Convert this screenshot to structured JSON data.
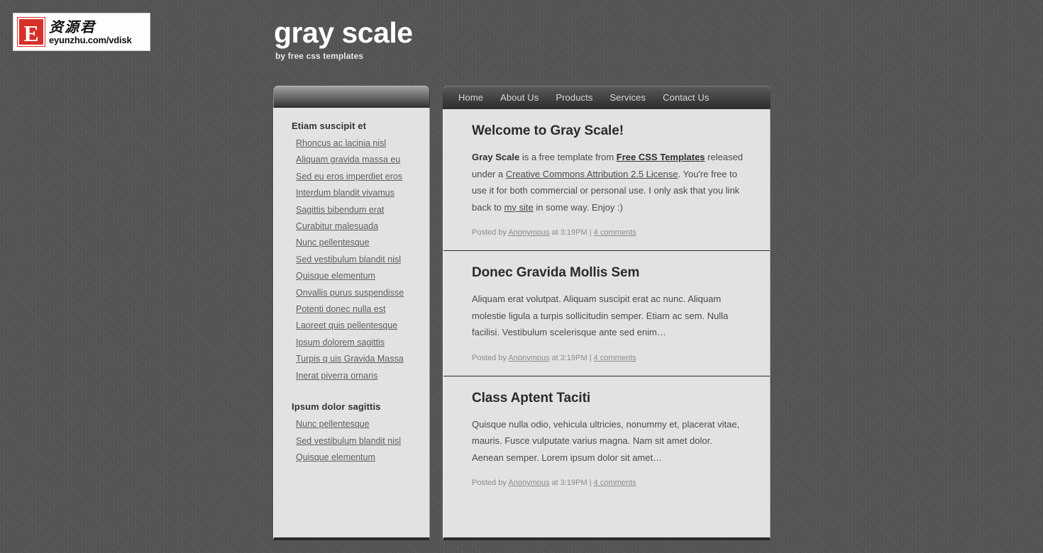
{
  "logo": {
    "mark_letter": "E",
    "chinese_text": "资源君",
    "url_text": "eyunzhu.com/vdisk"
  },
  "header": {
    "title": "gray scale",
    "tagline": "by free css templates"
  },
  "nav": {
    "items": [
      {
        "label": "Home"
      },
      {
        "label": "About Us"
      },
      {
        "label": "Products"
      },
      {
        "label": "Services"
      },
      {
        "label": "Contact Us"
      }
    ]
  },
  "sidebar": {
    "sections": [
      {
        "heading": "Etiam suscipit et",
        "links": [
          "Rhoncus ac lacinia nisl",
          "Aliquam gravida massa eu",
          "Sed eu eros imperdiet eros",
          "Interdum blandit vivamus",
          "Sagittis bibendum erat",
          "Curabitur malesuada",
          "Nunc pellentesque",
          "Sed vestibulum blandit nisl",
          "Quisque elementum",
          "Onvallis purus suspendisse",
          "Potenti donec nulla est",
          "Laoreet quis pellentesque",
          "Ipsum dolorem sagittis",
          "Turpis q uis Gravida Massa",
          "Inerat piverra ornaris"
        ]
      },
      {
        "heading": "Ipsum dolor sagittis",
        "links": [
          "Nunc pellentesque",
          "Sed vestibulum blandit nisl",
          "Quisque elementum"
        ]
      }
    ]
  },
  "posts": [
    {
      "title": "Welcome to Gray Scale!",
      "body_lead": "Gray Scale",
      "body_1": " is a free template from ",
      "link_1": "Free CSS Templates",
      "body_2": " released under a ",
      "link_2": "Creative Commons Attribution 2.5 License",
      "body_3": ". You're free to use it for both commercial or personal use. I only ask that you link back to ",
      "link_3": "my site",
      "body_4": " in some way. Enjoy :)",
      "meta_posted_by": "Posted by",
      "meta_author": "Anonymous",
      "meta_at": "at 3:19PM |",
      "meta_comments": "4 comments"
    },
    {
      "title": "Donec Gravida Mollis Sem",
      "body": "Aliquam erat volutpat. Aliquam suscipit erat ac nunc. Aliquam molestie ligula a turpis sollicitudin semper. Etiam ac sem. Nulla facilisi. Vestibulum scelerisque ante sed enim…",
      "meta_posted_by": "Posted by",
      "meta_author": "Anonymous",
      "meta_at": "at 3:19PM |",
      "meta_comments": "4 comments"
    },
    {
      "title": "Class Aptent Taciti",
      "body": "Quisque nulla odio, vehicula ultricies, nonummy et, placerat vitae, mauris. Fusce vulputate varius magna. Nam sit amet dolor. Aenean semper. Lorem ipsum dolor sit amet…",
      "meta_posted_by": "Posted by",
      "meta_author": "Anonymous",
      "meta_at": "at 3:19PM |",
      "meta_comments": "4 comments"
    }
  ],
  "colors": {
    "page_background": "#555555",
    "panel_background": "#e2e2e2",
    "accent_red": "#d6302a",
    "heading_text": "#2b2b2b",
    "body_text": "#4a4a4a",
    "meta_text": "#8b8b8b"
  }
}
